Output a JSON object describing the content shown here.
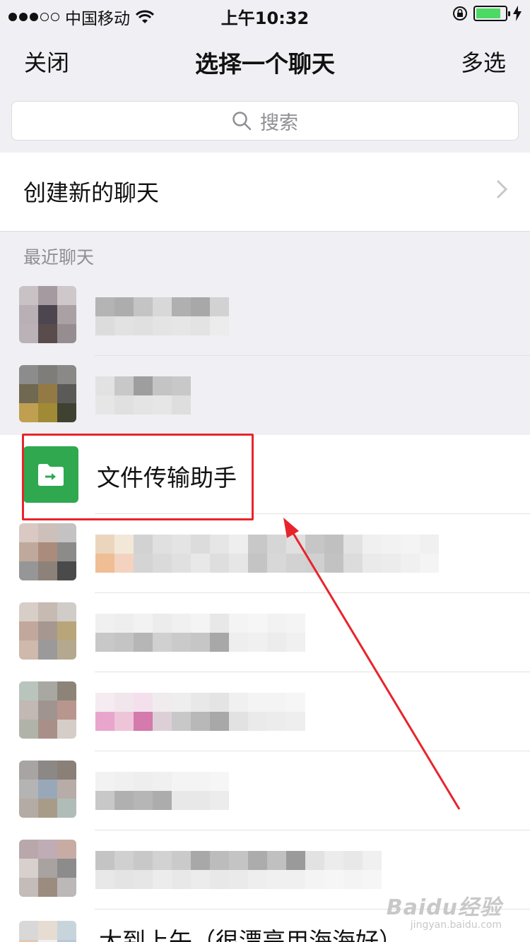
{
  "status_bar": {
    "carrier": "中国移动",
    "time": "上午10:32",
    "battery_level": 0.85
  },
  "nav": {
    "left_label": "关闭",
    "title": "选择一个聊天",
    "right_label": "多选"
  },
  "search": {
    "placeholder": "搜索"
  },
  "create_chat": {
    "label": "创建新的聊天"
  },
  "recent": {
    "header": "最近聊天",
    "file_assistant_name": "文件传输助手",
    "last_row_partial": "大到上午（很漂亮用海海好）"
  },
  "watermark": {
    "main": "Baidu经验",
    "sub": "jingyan.baidu.com"
  },
  "colors": {
    "nav_bg": "#efeff4",
    "assistant_green": "#2fa84f",
    "highlight_red": "#e8242b",
    "battery_green": "#4cd964"
  },
  "icons": [
    "wifi-icon",
    "search-icon",
    "chevron-right-icon",
    "folder-transfer-icon",
    "lock-rotation-icon",
    "charging-icon"
  ]
}
